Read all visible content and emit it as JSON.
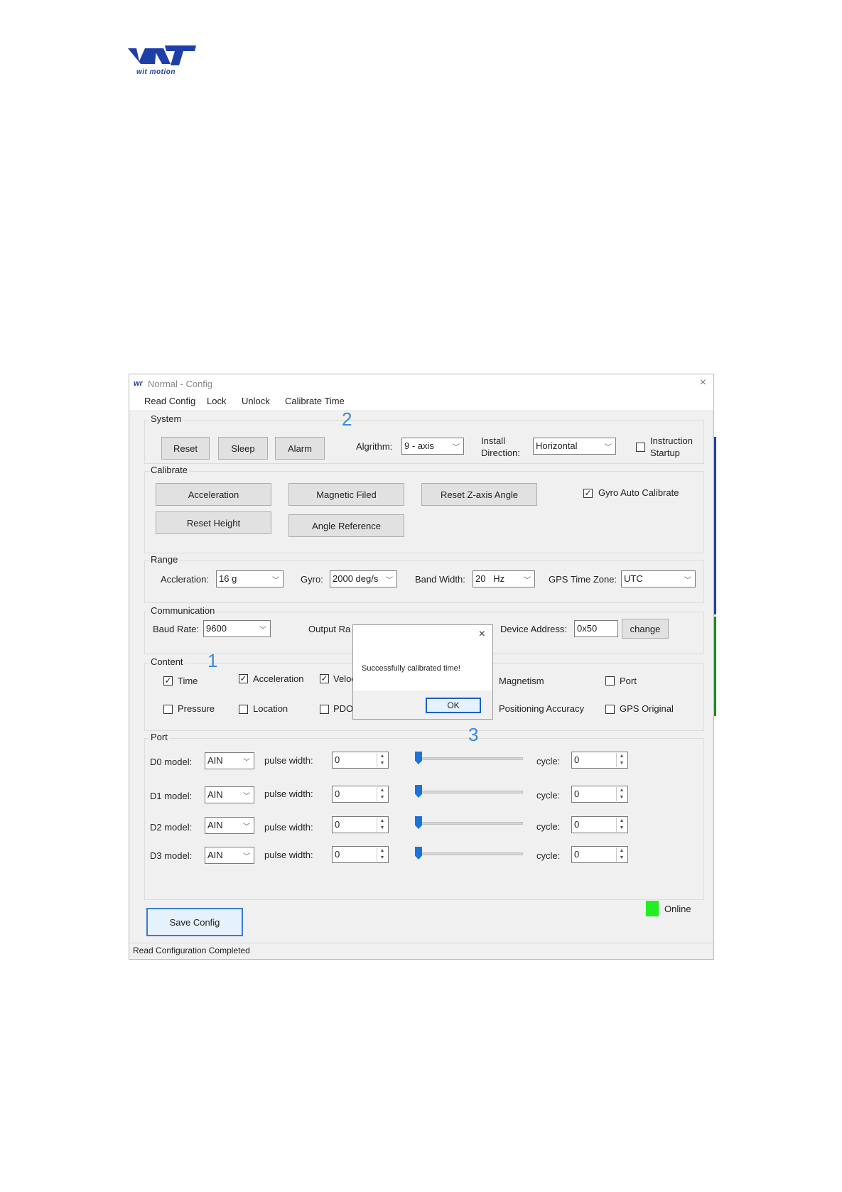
{
  "logo": {
    "text": "wit motion"
  },
  "window": {
    "title": "Normal - Config",
    "close": "×"
  },
  "menu": [
    "Read Config",
    "Lock",
    "Unlock",
    "Calibrate Time"
  ],
  "annotations": [
    "2",
    "1",
    "3"
  ],
  "system": {
    "label": "System",
    "buttons": [
      "Reset",
      "Sleep",
      "Alarm"
    ],
    "algorithm_label": "Algrithm:",
    "algorithm_value": "9 - axis",
    "install_label_1": "Install",
    "install_label_2": "Direction:",
    "install_value": "Horizontal",
    "instruction_label_1": "Instruction",
    "instruction_label_2": "Startup"
  },
  "calibrate": {
    "label": "Calibrate",
    "buttons": [
      "Acceleration",
      "Magnetic Filed",
      "Reset Z-axis Angle",
      "Reset Height",
      "Angle Reference"
    ],
    "gyro_auto": "Gyro Auto Calibrate"
  },
  "range": {
    "label": "Range",
    "accel_label": "Accleration:",
    "accel_value": "16 g",
    "gyro_label": "Gyro:",
    "gyro_value": "2000 deg/s",
    "bandwidth_label": "Band Width:",
    "bandwidth_value": "20   Hz",
    "gps_tz_label": "GPS Time Zone:",
    "gps_tz_value": "UTC"
  },
  "communication": {
    "label": "Communication",
    "baud_label": "Baud Rate:",
    "baud_value": "9600",
    "output_label": "Output Ra",
    "device_label": "Device Address:",
    "device_value": "0x50",
    "change_button": "change"
  },
  "content": {
    "label": "Content",
    "items": [
      {
        "label": "Time",
        "checked": true
      },
      {
        "label": "Acceleration",
        "checked": true
      },
      {
        "label": "Veloc",
        "checked": true
      },
      {
        "label": "Magnetism",
        "checked": false
      },
      {
        "label": "Port",
        "checked": false
      },
      {
        "label": "Pressure",
        "checked": false
      },
      {
        "label": "Location",
        "checked": false
      },
      {
        "label": "PDOP",
        "checked": false
      },
      {
        "label": "Positioning Accuracy",
        "checked": false
      },
      {
        "label": "GPS Original",
        "checked": false
      }
    ]
  },
  "port": {
    "label": "Port",
    "pulse_label": "pulse width:",
    "cycle_label": "cycle:",
    "rows": [
      {
        "model_label": "D0 model:",
        "model_value": "AIN",
        "pulse": "0",
        "cycle": "0"
      },
      {
        "model_label": "D1 model:",
        "model_value": "AIN",
        "pulse": "0",
        "cycle": "0"
      },
      {
        "model_label": "D2 model:",
        "model_value": "AIN",
        "pulse": "0",
        "cycle": "0"
      },
      {
        "model_label": "D3 model:",
        "model_value": "AIN",
        "pulse": "0",
        "cycle": "0"
      }
    ]
  },
  "online": {
    "label": "Online",
    "color": "#22ee22"
  },
  "save_button": "Save Config",
  "status_text": "Read Configuration Completed",
  "dialog": {
    "message": "Successfully calibrated time!",
    "ok": "OK",
    "close": "×"
  },
  "check_glyph": "✓",
  "chevron_glyph": "﹀",
  "spin_up": "▲",
  "spin_down": "▼"
}
